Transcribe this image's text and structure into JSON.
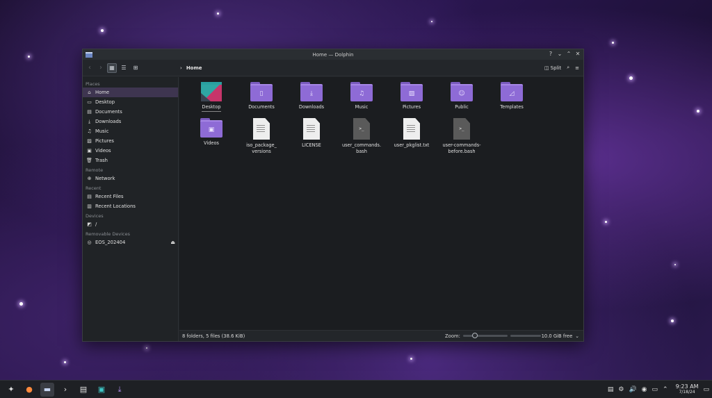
{
  "window": {
    "title": "Home — Dolphin",
    "controls": [
      "?",
      "⌄",
      "⌃",
      "✕"
    ]
  },
  "toolbar": {
    "breadcrumb": "Home",
    "split_label": "Split"
  },
  "sidebar": {
    "places_label": "Places",
    "places": [
      {
        "label": "Home",
        "icon": "home-icon"
      },
      {
        "label": "Desktop",
        "icon": "desktop-icon"
      },
      {
        "label": "Documents",
        "icon": "documents-icon"
      },
      {
        "label": "Downloads",
        "icon": "downloads-icon"
      },
      {
        "label": "Music",
        "icon": "music-icon"
      },
      {
        "label": "Pictures",
        "icon": "pictures-icon"
      },
      {
        "label": "Videos",
        "icon": "videos-icon"
      },
      {
        "label": "Trash",
        "icon": "trash-icon"
      }
    ],
    "remote_label": "Remote",
    "remote": [
      {
        "label": "Network",
        "icon": "network-icon"
      }
    ],
    "recent_label": "Recent",
    "recent": [
      {
        "label": "Recent Files",
        "icon": "recent-files-icon"
      },
      {
        "label": "Recent Locations",
        "icon": "recent-locations-icon"
      }
    ],
    "devices_label": "Devices",
    "devices": [
      {
        "label": "/",
        "icon": "drive-icon"
      }
    ],
    "removable_label": "Removable Devices",
    "removable": [
      {
        "label": "EOS_202404",
        "icon": "disc-icon"
      }
    ]
  },
  "files": {
    "folders": [
      {
        "label": "Desktop"
      },
      {
        "label": "Documents"
      },
      {
        "label": "Downloads"
      },
      {
        "label": "Music"
      },
      {
        "label": "Pictures"
      },
      {
        "label": "Public"
      },
      {
        "label": "Templates"
      },
      {
        "label": "Videos"
      }
    ],
    "files": [
      {
        "label": "iso_package_ versions"
      },
      {
        "label": "LICENSE"
      },
      {
        "label": "user_commands. bash"
      },
      {
        "label": "user_pkglist.txt"
      },
      {
        "label": "user-commands- before.bash"
      }
    ]
  },
  "status": {
    "summary": "8 folders, 5 files (38.6 KiB)",
    "zoom_label": "Zoom:",
    "free_space": "10.0 GiB free"
  },
  "taskbar": {
    "time": "9:23 AM",
    "date": "7/18/24"
  },
  "colors": {
    "accent": "#8e6bd6",
    "selection": "#3e3550"
  }
}
